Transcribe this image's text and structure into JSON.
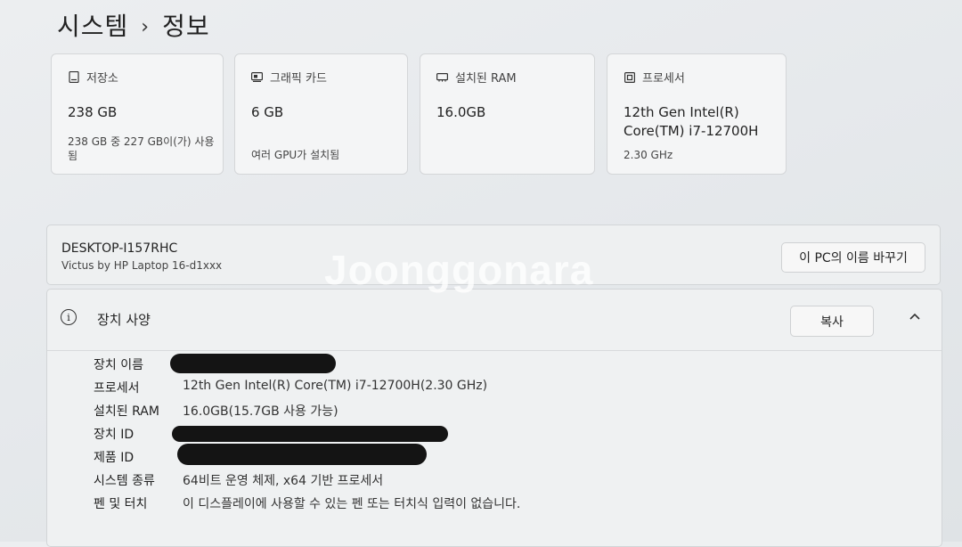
{
  "breadcrumb": {
    "parent": "시스템",
    "separator": "›",
    "current": "정보"
  },
  "cards": [
    {
      "title": "저장소",
      "value": "238 GB",
      "sub": "238 GB 중 227 GB이(가) 사용됨",
      "icon": "storage-icon"
    },
    {
      "title": "그래픽 카드",
      "value": "6 GB",
      "sub": "여러 GPU가 설치됨",
      "icon": "graphics-card-icon"
    },
    {
      "title": "설치된 RAM",
      "value": "16.0GB",
      "sub": "",
      "icon": "ram-icon"
    },
    {
      "title": "프로세서",
      "value": "12th Gen Intel(R) Core(TM) i7-12700H",
      "sub": "2.30 GHz",
      "icon": "processor-icon"
    }
  ],
  "device": {
    "pc_name": "DESKTOP-I157RHC",
    "model": "Victus by HP Laptop 16-d1xxx",
    "rename_label": "이 PC의 이름 바꾸기"
  },
  "specs": {
    "title": "장치 사양",
    "copy_label": "복사",
    "rows": [
      {
        "label": "장치 이름",
        "value": ""
      },
      {
        "label": "프로세서",
        "value": "12th Gen Intel(R) Core(TM) i7-12700H(2.30 GHz)"
      },
      {
        "label": "설치된 RAM",
        "value": "16.0GB(15.7GB 사용 가능)"
      },
      {
        "label": "장치 ID",
        "value": ""
      },
      {
        "label": "제품 ID",
        "value": ""
      },
      {
        "label": "시스템 종류",
        "value": "64비트 운영 체제, x64 기반 프로세서"
      },
      {
        "label": "펜 및 터치",
        "value": "이 디스플레이에 사용할 수 있는 펜 또는 터치식 입력이 없습니다."
      }
    ]
  },
  "watermark": "Joonggonara"
}
